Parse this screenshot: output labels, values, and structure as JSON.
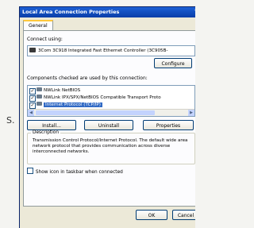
{
  "stray_text": "S.",
  "window": {
    "title": "Local Area Connection Properties",
    "help": "?"
  },
  "tabs": [
    {
      "label": "General"
    }
  ],
  "connect_using": {
    "label": "Connect using:",
    "adapter": "3Com 3C918 Integrated Fast Ethernet Controller (3C905B-",
    "configure_button": "Configure"
  },
  "components": {
    "label": "Components checked are used by this connection:",
    "items": [
      {
        "label": "NWLink NetBIOS",
        "checked": true,
        "selected": false
      },
      {
        "label": "NWLink IPX/SPX/NetBIOS Compatible Transport Proto",
        "checked": true,
        "selected": false
      },
      {
        "label": "Internet Protocol (TCP/IP)",
        "checked": true,
        "selected": true
      }
    ]
  },
  "buttons": {
    "install": "Install...",
    "uninstall": "Uninstall",
    "properties": "Properties",
    "ok": "OK",
    "cancel": "Cancel"
  },
  "description": {
    "legend": "Description",
    "text": "Transmission Control Protocol/Internet Protocol. The default wide area network protocol that provides communication across diverse interconnected networks."
  },
  "show_icon": {
    "label": "Show icon in taskbar when connected",
    "checked": false
  },
  "colors": {
    "titlebar": "#0a3ea8",
    "selection": "#316ac5",
    "tab_accent": "#ffc83c"
  }
}
